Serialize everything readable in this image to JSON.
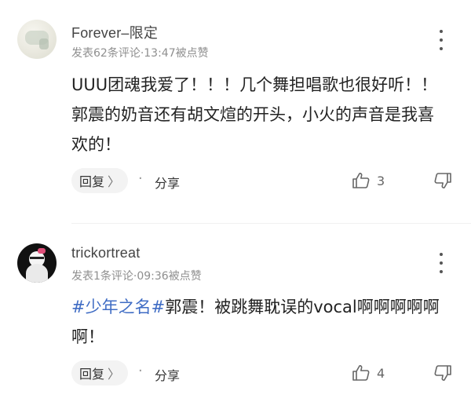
{
  "comments": [
    {
      "username": "Forever–限定",
      "meta": "发表62条评论·13:47被点赞",
      "content_parts": [
        {
          "text": "UUU团魂我爱了！！！几个舞担唱歌也很好听！！郭震的奶音还有胡文煊的开头，小火的声音是我喜欢的！",
          "tag": false
        }
      ],
      "reply_label": "回复",
      "reply_chevron": "〉",
      "separator": "·",
      "share_label": "分享",
      "like_count": "3",
      "icons": {
        "like": "thumbs-up-icon",
        "dislike": "thumbs-down-icon",
        "more": "more-vertical-icon"
      }
    },
    {
      "username": "trickortreat",
      "meta": "发表1条评论·09:36被点赞",
      "content_parts": [
        {
          "text": "#少年之名#",
          "tag": true
        },
        {
          "text": "郭震！被跳舞耽误的vocal啊啊啊啊啊啊！",
          "tag": false
        }
      ],
      "reply_label": "回复",
      "reply_chevron": "〉",
      "separator": "·",
      "share_label": "分享",
      "like_count": "4",
      "icons": {
        "like": "thumbs-up-icon",
        "dislike": "thumbs-down-icon",
        "more": "more-vertical-icon"
      }
    }
  ],
  "colors": {
    "hashtag": "#3f6cc4",
    "meta": "#8f8f8f",
    "text": "#222222"
  }
}
